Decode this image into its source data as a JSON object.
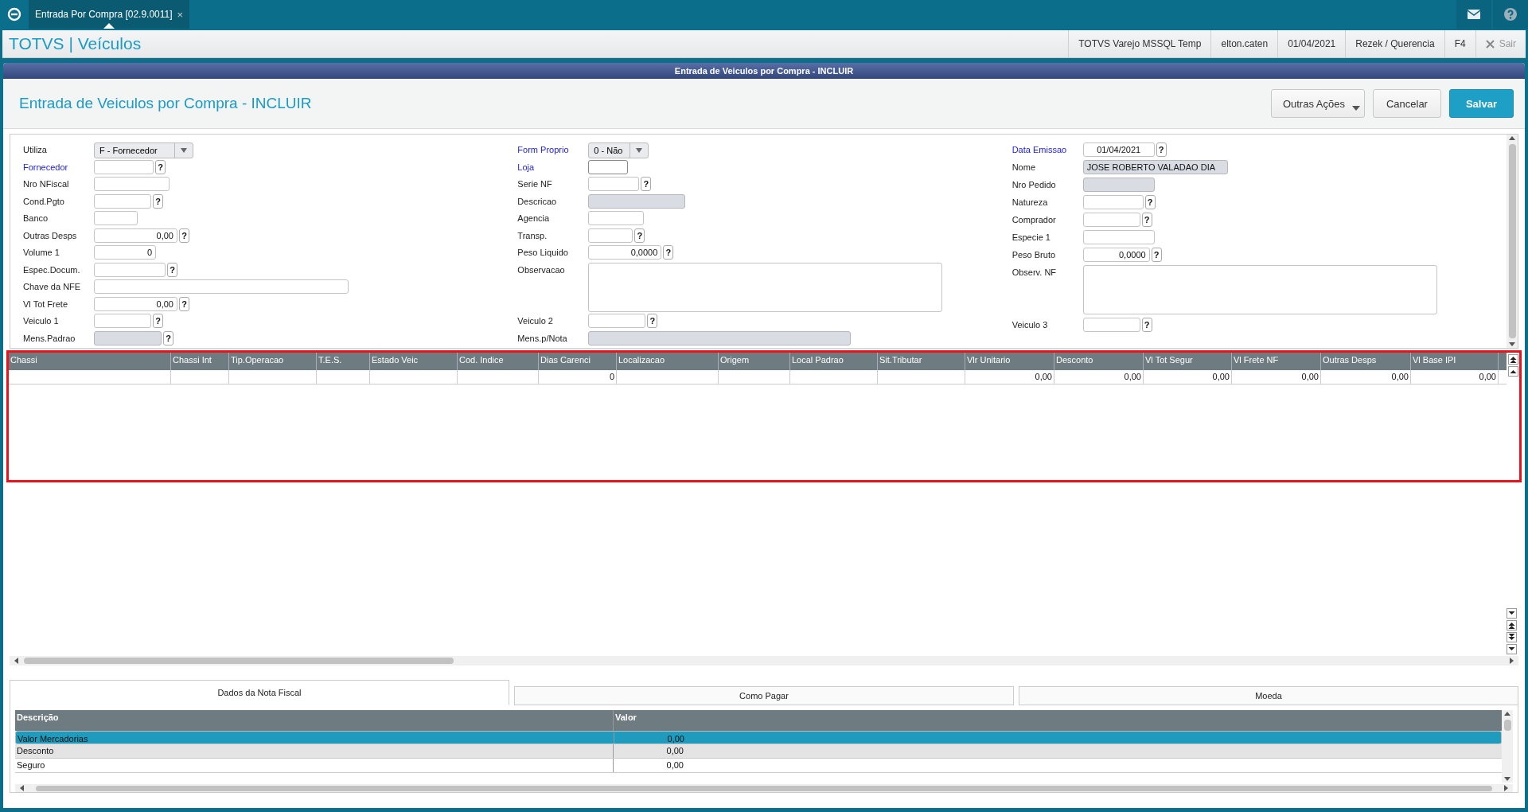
{
  "top_bar": {
    "tab": {
      "label": "Entrada Por Compra [02.9.0011]",
      "close": "×"
    }
  },
  "header": {
    "brand": "TOTVS | Veículos",
    "info": [
      "TOTVS Varejo MSSQL Temp",
      "elton.caten",
      "01/04/2021",
      "Rezek / Querencia",
      "F4"
    ],
    "exit": {
      "label": "Sair",
      "disabled": true
    }
  },
  "dialog": {
    "title": "Entrada de Veiculos por Compra - INCLUIR",
    "heading": "Entrada de Veiculos por Compra - INCLUIR",
    "buttons": [
      {
        "label": "Outras Ações",
        "kind": "menu"
      },
      {
        "label": "Cancelar",
        "kind": "plain"
      },
      {
        "label": "Salvar",
        "kind": "primary"
      }
    ]
  },
  "form": {
    "columns": [
      [
        {
          "label": "Utiliza",
          "kind": "select",
          "value": "F - Fornecedor",
          "required": false
        },
        {
          "label": "Fornecedor",
          "kind": "text",
          "required": true,
          "disabled": false,
          "help": "?"
        },
        {
          "label": "Nro NFiscal",
          "kind": "text",
          "required": false,
          "disabled": false
        },
        {
          "label": "Cond.Pgto",
          "kind": "text",
          "required": false,
          "disabled": false,
          "help": "?"
        },
        {
          "label": "Banco",
          "kind": "text",
          "required": false,
          "disabled": false
        },
        {
          "label": "Outras Desps",
          "kind": "number",
          "value": "0,00",
          "required": false,
          "disabled": false,
          "help": "?"
        },
        {
          "label": "Volume 1",
          "kind": "number",
          "value": "0",
          "required": false,
          "disabled": false
        },
        {
          "label": "Espec.Docum.",
          "kind": "text",
          "required": false,
          "disabled": false,
          "help": "?"
        },
        {
          "label": "Chave da NFE",
          "kind": "text",
          "required": false,
          "disabled": false
        },
        {
          "label": "Vl Tot Frete",
          "kind": "number",
          "value": "0,00",
          "required": false,
          "disabled": false,
          "help": "?"
        },
        {
          "label": "Veiculo 1",
          "kind": "text",
          "required": false,
          "disabled": false,
          "help": "?"
        },
        {
          "label": "Mens.Padrao",
          "kind": "text",
          "required": false,
          "disabled": true,
          "help": "?"
        }
      ],
      [
        {
          "label": "Form Proprio",
          "kind": "select",
          "value": "0 - Não",
          "required": true
        },
        {
          "label": "Loja",
          "kind": "text",
          "required": true,
          "disabled": false,
          "focused": true
        },
        {
          "label": "Serie NF",
          "kind": "text",
          "required": false,
          "disabled": false,
          "help": "?"
        },
        {
          "label": "Descricao",
          "kind": "text",
          "required": false,
          "disabled": true
        },
        {
          "label": "Agencia",
          "kind": "text",
          "required": false,
          "disabled": false
        },
        {
          "label": "Transp.",
          "kind": "text",
          "required": false,
          "disabled": false,
          "help": "?"
        },
        {
          "label": "Peso Liquido",
          "kind": "number",
          "value": "0,0000",
          "required": false,
          "disabled": false,
          "help": "?"
        },
        {
          "label": "Observacao",
          "kind": "textarea",
          "required": false,
          "disabled": false
        },
        {
          "label": "Veiculo 2",
          "kind": "text",
          "required": false,
          "disabled": false,
          "help": "?"
        },
        {
          "label": "Mens.p/Nota",
          "kind": "text",
          "required": false,
          "disabled": true
        }
      ],
      [
        {
          "label": "Data Emissao",
          "kind": "date",
          "value": "01/04/2021",
          "required": true,
          "disabled": false,
          "help": "?"
        },
        {
          "label": "Nome",
          "kind": "text",
          "value": "JOSE ROBERTO VALADAO DIA",
          "required": false,
          "disabled": true
        },
        {
          "label": "Nro Pedido",
          "kind": "text",
          "required": false,
          "disabled": true
        },
        {
          "label": "Natureza",
          "kind": "text",
          "required": false,
          "disabled": false,
          "help": "?"
        },
        {
          "label": "Comprador",
          "kind": "text",
          "required": false,
          "disabled": false,
          "help": "?"
        },
        {
          "label": "Especie 1",
          "kind": "text",
          "required": false,
          "disabled": false
        },
        {
          "label": "Peso Bruto",
          "kind": "number",
          "value": "0,0000",
          "required": false,
          "disabled": false,
          "help": "?"
        },
        {
          "label": "Observ. NF",
          "kind": "textarea",
          "required": false,
          "disabled": false
        },
        {
          "label": "Veiculo 3",
          "kind": "text",
          "required": false,
          "disabled": false,
          "help": "?"
        }
      ]
    ]
  },
  "grid": {
    "columns": [
      "Chassi",
      "Chassi Int",
      "Tip.Operacao",
      "T.E.S.",
      "Estado Veic",
      "Cod. Indice",
      "Dias Carenci",
      "Localizacao",
      "Origem",
      "Local Padrao",
      "Sit.Tributar",
      "Vlr Unitario",
      "Desconto",
      "Vl Tot Segur",
      "Vl Frete NF",
      "Outras Desps",
      "Vl Base IPI"
    ],
    "rows": [
      [
        "",
        "",
        "",
        "",
        "",
        "",
        "0",
        "",
        "",
        "",
        "",
        "0,00",
        "0,00",
        "0,00",
        "0,00",
        "0,00",
        "0,00"
      ]
    ]
  },
  "tabs": [
    {
      "label": "Dados da Nota Fiscal",
      "selected": true
    },
    {
      "label": "Como Pagar",
      "selected": false
    },
    {
      "label": "Moeda",
      "selected": false
    }
  ],
  "totals": {
    "columns": [
      "Descrição",
      "Valor"
    ],
    "rows": [
      {
        "cells": [
          "Valor Mercadorias",
          "0,00"
        ],
        "selected": true
      },
      {
        "cells": [
          "Desconto",
          "0,00"
        ],
        "selected": false
      },
      {
        "cells": [
          "Seguro",
          "0,00"
        ],
        "selected": false
      }
    ]
  }
}
